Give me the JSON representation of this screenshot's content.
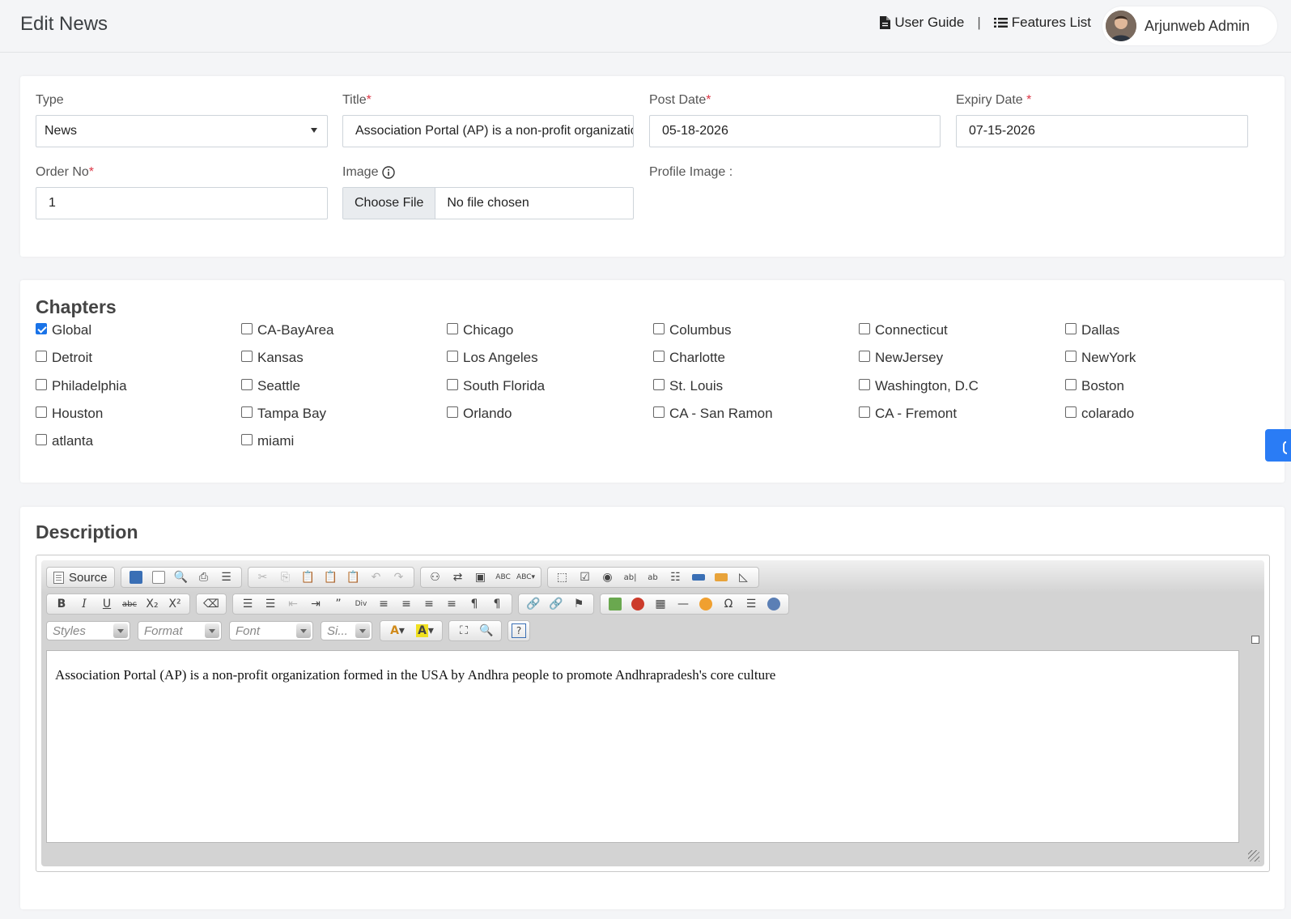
{
  "header": {
    "page_title": "Edit News",
    "user_guide": "User Guide",
    "separator": "|",
    "features_list": "Features List",
    "user_name": "Arjunweb Admin"
  },
  "form": {
    "type_label": "Type",
    "type_value": "News",
    "title_label": "Title",
    "title_value": "Association Portal (AP) is a non-profit organization",
    "post_date_label": "Post Date",
    "post_date_value": "05-18-2026",
    "expiry_date_label": "Expiry Date ",
    "expiry_date_value": "07-15-2026",
    "order_no_label": "Order No",
    "order_no_value": "1",
    "image_label": "Image",
    "choose_file": "Choose File",
    "no_file": "No file chosen",
    "profile_image_label": "Profile Image :",
    "required_mark": "*"
  },
  "chapters": {
    "title": "Chapters",
    "items": [
      {
        "label": "Global",
        "checked": true
      },
      {
        "label": "CA-BayArea",
        "checked": false
      },
      {
        "label": "Chicago",
        "checked": false
      },
      {
        "label": "Columbus",
        "checked": false
      },
      {
        "label": "Connecticut",
        "checked": false
      },
      {
        "label": "Dallas",
        "checked": false
      },
      {
        "label": "Detroit",
        "checked": false
      },
      {
        "label": "Kansas",
        "checked": false
      },
      {
        "label": "Los Angeles",
        "checked": false
      },
      {
        "label": "Charlotte",
        "checked": false
      },
      {
        "label": "NewJersey",
        "checked": false
      },
      {
        "label": "NewYork",
        "checked": false
      },
      {
        "label": "Philadelphia",
        "checked": false
      },
      {
        "label": "Seattle",
        "checked": false
      },
      {
        "label": "South Florida",
        "checked": false
      },
      {
        "label": "St. Louis",
        "checked": false
      },
      {
        "label": "Washington, D.C",
        "checked": false
      },
      {
        "label": "Boston",
        "checked": false
      },
      {
        "label": "Houston",
        "checked": false
      },
      {
        "label": "Tampa Bay",
        "checked": false
      },
      {
        "label": "Orlando",
        "checked": false
      },
      {
        "label": "CA - San Ramon",
        "checked": false
      },
      {
        "label": "CA - Fremont",
        "checked": false
      },
      {
        "label": "colarado",
        "checked": false
      },
      {
        "label": "atlanta",
        "checked": false
      },
      {
        "label": "miami",
        "checked": false
      }
    ]
  },
  "description": {
    "title": "Description",
    "source_label": "Source",
    "combo_styles": "Styles",
    "combo_format": "Format",
    "combo_font": "Font",
    "combo_size": "Si...",
    "content": "Association Portal (AP) is a non-profit organization formed in the USA by Andhra people to promote Andhrapradesh's core culture"
  }
}
